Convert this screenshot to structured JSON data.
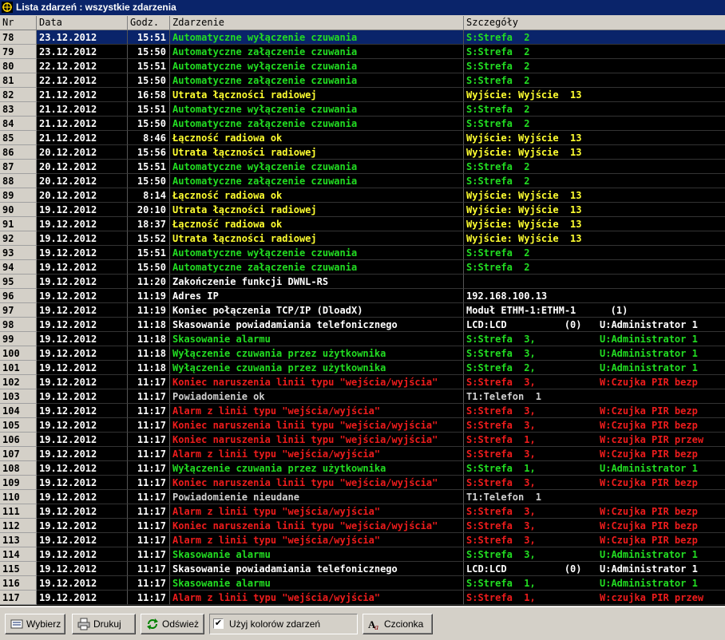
{
  "window": {
    "title": "Lista zdarzeń : wszystkie zdarzenia"
  },
  "columns": {
    "nr": "Nr",
    "date": "Data",
    "time": "Godz.",
    "event": "Zdarzenie",
    "details": "Szczegóły"
  },
  "colors": {
    "green": "#22dd22",
    "yellow": "#ffff30",
    "white": "#ffffff",
    "red": "#ee1c1c",
    "gray": "#d0d0d0",
    "selection": "#0a246a"
  },
  "events": [
    {
      "nr": "78",
      "date": "23.12.2012",
      "time": "15:51",
      "event": "Automatyczne wyłączenie czuwania",
      "d1": "S:Strefa  2",
      "d2": "",
      "color": "green",
      "selected": true
    },
    {
      "nr": "79",
      "date": "23.12.2012",
      "time": "15:50",
      "event": "Automatyczne załączenie czuwania",
      "d1": "S:Strefa  2",
      "d2": "",
      "color": "green"
    },
    {
      "nr": "80",
      "date": "22.12.2012",
      "time": "15:51",
      "event": "Automatyczne wyłączenie czuwania",
      "d1": "S:Strefa  2",
      "d2": "",
      "color": "green"
    },
    {
      "nr": "81",
      "date": "22.12.2012",
      "time": "15:50",
      "event": "Automatyczne załączenie czuwania",
      "d1": "S:Strefa  2",
      "d2": "",
      "color": "green"
    },
    {
      "nr": "82",
      "date": "21.12.2012",
      "time": "16:58",
      "event": "Utrata łączności radiowej",
      "d1": "Wyjście: Wyjście  13",
      "d2": "",
      "color": "yellow"
    },
    {
      "nr": "83",
      "date": "21.12.2012",
      "time": "15:51",
      "event": "Automatyczne wyłączenie czuwania",
      "d1": "S:Strefa  2",
      "d2": "",
      "color": "green"
    },
    {
      "nr": "84",
      "date": "21.12.2012",
      "time": "15:50",
      "event": "Automatyczne załączenie czuwania",
      "d1": "S:Strefa  2",
      "d2": "",
      "color": "green"
    },
    {
      "nr": "85",
      "date": "21.12.2012",
      "time": "8:46",
      "event": "Łączność radiowa ok",
      "d1": "Wyjście: Wyjście  13",
      "d2": "",
      "color": "yellow"
    },
    {
      "nr": "86",
      "date": "20.12.2012",
      "time": "15:56",
      "event": "Utrata łączności radiowej",
      "d1": "Wyjście: Wyjście  13",
      "d2": "",
      "color": "yellow"
    },
    {
      "nr": "87",
      "date": "20.12.2012",
      "time": "15:51",
      "event": "Automatyczne wyłączenie czuwania",
      "d1": "S:Strefa  2",
      "d2": "",
      "color": "green"
    },
    {
      "nr": "88",
      "date": "20.12.2012",
      "time": "15:50",
      "event": "Automatyczne załączenie czuwania",
      "d1": "S:Strefa  2",
      "d2": "",
      "color": "green"
    },
    {
      "nr": "89",
      "date": "20.12.2012",
      "time": "8:14",
      "event": "Łączność radiowa ok",
      "d1": "Wyjście: Wyjście  13",
      "d2": "",
      "color": "yellow"
    },
    {
      "nr": "90",
      "date": "19.12.2012",
      "time": "20:10",
      "event": "Utrata łączności radiowej",
      "d1": "Wyjście: Wyjście  13",
      "d2": "",
      "color": "yellow"
    },
    {
      "nr": "91",
      "date": "19.12.2012",
      "time": "18:37",
      "event": "Łączność radiowa ok",
      "d1": "Wyjście: Wyjście  13",
      "d2": "",
      "color": "yellow"
    },
    {
      "nr": "92",
      "date": "19.12.2012",
      "time": "15:52",
      "event": "Utrata łączności radiowej",
      "d1": "Wyjście: Wyjście  13",
      "d2": "",
      "color": "yellow"
    },
    {
      "nr": "93",
      "date": "19.12.2012",
      "time": "15:51",
      "event": "Automatyczne wyłączenie czuwania",
      "d1": "S:Strefa  2",
      "d2": "",
      "color": "green"
    },
    {
      "nr": "94",
      "date": "19.12.2012",
      "time": "15:50",
      "event": "Automatyczne załączenie czuwania",
      "d1": "S:Strefa  2",
      "d2": "",
      "color": "green"
    },
    {
      "nr": "95",
      "date": "19.12.2012",
      "time": "11:20",
      "event": "Zakończenie funkcji DWNL-RS",
      "d1": "",
      "d2": "",
      "color": "white"
    },
    {
      "nr": "96",
      "date": "19.12.2012",
      "time": "11:19",
      "event": "Adres IP",
      "d1": "192.168.100.13",
      "d2": "",
      "color": "white"
    },
    {
      "nr": "97",
      "date": "19.12.2012",
      "time": "11:19",
      "event": "Koniec połączenia TCP/IP (DloadX)",
      "d1": "Moduł ETHM-1:ETHM-1      (1)",
      "d2": "",
      "color": "white"
    },
    {
      "nr": "98",
      "date": "19.12.2012",
      "time": "11:18",
      "event": "Skasowanie powiadamiania telefonicznego",
      "d1": "LCD:LCD          (0)",
      "d2": "U:Administrator 1",
      "color": "white"
    },
    {
      "nr": "99",
      "date": "19.12.2012",
      "time": "11:18",
      "event": "Skasowanie alarmu",
      "d1": "S:Strefa  3,",
      "d2": "U:Administrator 1",
      "color": "green"
    },
    {
      "nr": "100",
      "date": "19.12.2012",
      "time": "11:18",
      "event": "Wyłączenie czuwania przez użytkownika",
      "d1": "S:Strefa  3,",
      "d2": "U:Administrator 1",
      "color": "green"
    },
    {
      "nr": "101",
      "date": "19.12.2012",
      "time": "11:18",
      "event": "Wyłączenie czuwania przez użytkownika",
      "d1": "S:Strefa  2,",
      "d2": "U:Administrator 1",
      "color": "green"
    },
    {
      "nr": "102",
      "date": "19.12.2012",
      "time": "11:17",
      "event": "Koniec naruszenia linii typu \"wejścia/wyjścia\"",
      "d1": "S:Strefa  3,",
      "d2": "W:Czujka PIR bezp",
      "color": "red"
    },
    {
      "nr": "103",
      "date": "19.12.2012",
      "time": "11:17",
      "event": "Powiadomienie ok",
      "d1": "T1:Telefon  1",
      "d2": "",
      "color": "gray"
    },
    {
      "nr": "104",
      "date": "19.12.2012",
      "time": "11:17",
      "event": "Alarm z linii typu \"wejścia/wyjścia\"",
      "d1": "S:Strefa  3,",
      "d2": "W:Czujka PIR bezp",
      "color": "red"
    },
    {
      "nr": "105",
      "date": "19.12.2012",
      "time": "11:17",
      "event": "Koniec naruszenia linii typu \"wejścia/wyjścia\"",
      "d1": "S:Strefa  3,",
      "d2": "W:Czujka PIR bezp",
      "color": "red"
    },
    {
      "nr": "106",
      "date": "19.12.2012",
      "time": "11:17",
      "event": "Koniec naruszenia linii typu \"wejścia/wyjścia\"",
      "d1": "S:Strefa  1,",
      "d2": "W:czujka PIR przew",
      "color": "red"
    },
    {
      "nr": "107",
      "date": "19.12.2012",
      "time": "11:17",
      "event": "Alarm z linii typu \"wejścia/wyjścia\"",
      "d1": "S:Strefa  3,",
      "d2": "W:Czujka PIR bezp",
      "color": "red"
    },
    {
      "nr": "108",
      "date": "19.12.2012",
      "time": "11:17",
      "event": "Wyłączenie czuwania przez użytkownika",
      "d1": "S:Strefa  1,",
      "d2": "U:Administrator 1",
      "color": "green"
    },
    {
      "nr": "109",
      "date": "19.12.2012",
      "time": "11:17",
      "event": "Koniec naruszenia linii typu \"wejścia/wyjścia\"",
      "d1": "S:Strefa  3,",
      "d2": "W:Czujka PIR bezp",
      "color": "red"
    },
    {
      "nr": "110",
      "date": "19.12.2012",
      "time": "11:17",
      "event": "Powiadomienie nieudane",
      "d1": "T1:Telefon  1",
      "d2": "",
      "color": "gray"
    },
    {
      "nr": "111",
      "date": "19.12.2012",
      "time": "11:17",
      "event": "Alarm z linii typu \"wejścia/wyjścia\"",
      "d1": "S:Strefa  3,",
      "d2": "W:Czujka PIR bezp",
      "color": "red"
    },
    {
      "nr": "112",
      "date": "19.12.2012",
      "time": "11:17",
      "event": "Koniec naruszenia linii typu \"wejścia/wyjścia\"",
      "d1": "S:Strefa  3,",
      "d2": "W:Czujka PIR bezp",
      "color": "red"
    },
    {
      "nr": "113",
      "date": "19.12.2012",
      "time": "11:17",
      "event": "Alarm z linii typu \"wejścia/wyjścia\"",
      "d1": "S:Strefa  3,",
      "d2": "W:Czujka PIR bezp",
      "color": "red"
    },
    {
      "nr": "114",
      "date": "19.12.2012",
      "time": "11:17",
      "event": "Skasowanie alarmu",
      "d1": "S:Strefa  3,",
      "d2": "U:Administrator 1",
      "color": "green"
    },
    {
      "nr": "115",
      "date": "19.12.2012",
      "time": "11:17",
      "event": "Skasowanie powiadamiania telefonicznego",
      "d1": "LCD:LCD          (0)",
      "d2": "U:Administrator 1",
      "color": "white"
    },
    {
      "nr": "116",
      "date": "19.12.2012",
      "time": "11:17",
      "event": "Skasowanie alarmu",
      "d1": "S:Strefa  1,",
      "d2": "U:Administrator 1",
      "color": "green"
    },
    {
      "nr": "117",
      "date": "19.12.2012",
      "time": "11:17",
      "event": "Alarm z linii typu \"wejścia/wyjścia\"",
      "d1": "S:Strefa  1,",
      "d2": "W:czujka PIR przew",
      "color": "red"
    }
  ],
  "toolbar": {
    "select_label": "Wybierz",
    "print_label": "Drukuj",
    "refresh_label": "Odśwież",
    "use_colors_label": "Użyj kolorów zdarzeń",
    "use_colors_checked": true,
    "font_label": "Czcionka"
  }
}
